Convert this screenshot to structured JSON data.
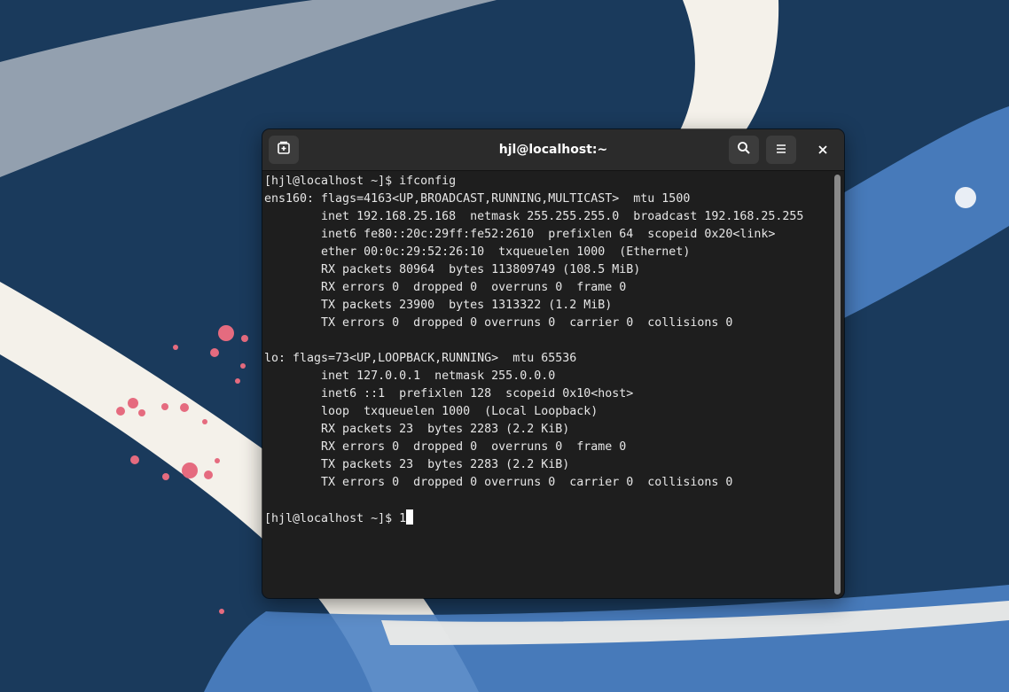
{
  "window": {
    "title": "hjl@localhost:~"
  },
  "icons": {
    "new_tab": "new-tab-icon",
    "search": "search-icon",
    "menu": "hamburger-menu-icon",
    "close": "close-icon"
  },
  "terminal": {
    "lines": [
      "[hjl@localhost ~]$ ifconfig",
      "ens160: flags=4163<UP,BROADCAST,RUNNING,MULTICAST>  mtu 1500",
      "        inet 192.168.25.168  netmask 255.255.255.0  broadcast 192.168.25.255",
      "        inet6 fe80::20c:29ff:fe52:2610  prefixlen 64  scopeid 0x20<link>",
      "        ether 00:0c:29:52:26:10  txqueuelen 1000  (Ethernet)",
      "        RX packets 80964  bytes 113809749 (108.5 MiB)",
      "        RX errors 0  dropped 0  overruns 0  frame 0",
      "        TX packets 23900  bytes 1313322 (1.2 MiB)",
      "        TX errors 0  dropped 0 overruns 0  carrier 0  collisions 0",
      "",
      "lo: flags=73<UP,LOOPBACK,RUNNING>  mtu 65536",
      "        inet 127.0.0.1  netmask 255.0.0.0",
      "        inet6 ::1  prefixlen 128  scopeid 0x10<host>",
      "        loop  txqueuelen 1000  (Local Loopback)",
      "        RX packets 23  bytes 2283 (2.2 KiB)",
      "        RX errors 0  dropped 0  overruns 0  frame 0",
      "        TX packets 23  bytes 2283 (2.2 KiB)",
      "        TX errors 0  dropped 0 overruns 0  carrier 0  collisions 0",
      ""
    ],
    "prompt": "[hjl@localhost ~]$ ",
    "current_input": "1"
  },
  "colors": {
    "desktop_background": "#1a3a5c",
    "terminal_background": "#1e1e1e",
    "headerbar_background": "#2b2b2b",
    "terminal_foreground": "#e6e6e6"
  }
}
